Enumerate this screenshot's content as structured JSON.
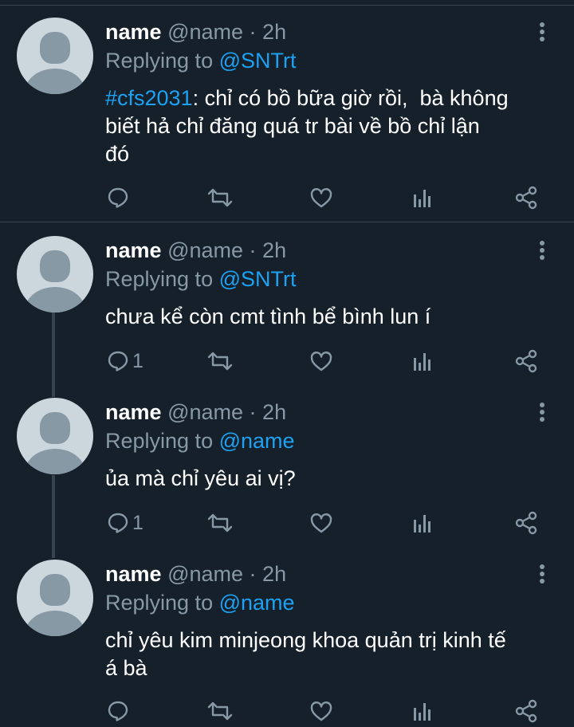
{
  "tweets": [
    {
      "display_name": "name",
      "handle": "@name",
      "separator": "·",
      "time": "2h",
      "replying_prefix": "Replying to",
      "replying_to": "@SNTrt",
      "hashtag": "#cfs2031",
      "text": ": chỉ có bồ bữa giờ rồi,  bà không\nbiết hả chỉ đăng quá tr bài về bồ chỉ lận\nđó",
      "reply_count": ""
    },
    {
      "display_name": "name",
      "handle": "@name",
      "separator": "·",
      "time": "2h",
      "replying_prefix": "Replying to",
      "replying_to": "@SNTrt",
      "text": "chưa kể còn cmt tình bể bình lun í",
      "reply_count": "1"
    },
    {
      "display_name": "name",
      "handle": "@name",
      "separator": "·",
      "time": "2h",
      "replying_prefix": "Replying to",
      "replying_to": "@name",
      "text": "ủa mà chỉ yêu ai vị?",
      "reply_count": "1"
    },
    {
      "display_name": "name",
      "handle": "@name",
      "separator": "·",
      "time": "2h",
      "replying_prefix": "Replying to",
      "replying_to": "@name",
      "text": "chỉ yêu kim minjeong khoa quản trị kinh tế\ná bà",
      "reply_count": ""
    }
  ],
  "icons": {
    "reply": "reply-icon",
    "retweet": "retweet-icon",
    "like": "like-icon",
    "analytics": "analytics-icon",
    "share": "share-icon",
    "more": "more-vertical-icon"
  },
  "colors": {
    "background": "#15202b",
    "accent": "#1da1f2",
    "muted": "#8899a6",
    "divider": "#38444d"
  }
}
